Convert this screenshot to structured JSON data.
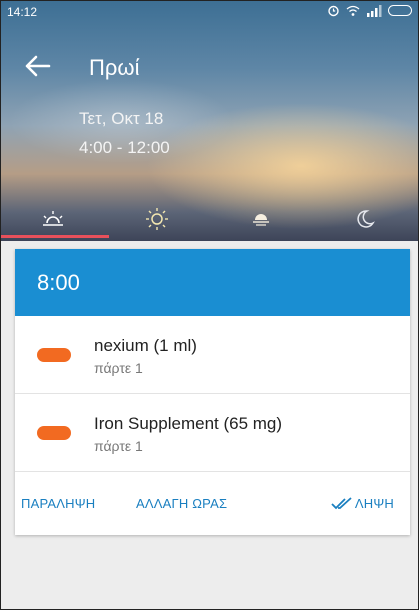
{
  "status_bar": {
    "time": "14:12"
  },
  "header": {
    "title": "Πρωί",
    "date": "Τετ, Οκτ 18",
    "time_range": "4:00 - 12:00"
  },
  "tabs": [
    {
      "icon": "sunrise-icon",
      "active": true
    },
    {
      "icon": "sun-icon",
      "active": false
    },
    {
      "icon": "sunset-icon",
      "active": false
    },
    {
      "icon": "moon-icon",
      "active": false
    }
  ],
  "card": {
    "time": "8:00",
    "meds": [
      {
        "name": "nexium (1 ml)",
        "dose": "πάρτε 1"
      },
      {
        "name": "Iron Supplement (65 mg)",
        "dose": "πάρτε 1"
      }
    ],
    "actions": {
      "skip": "ΠΑΡΑΛΗΨΗ",
      "change_time": "ΑΛΛΑΓΗ ΩΡΑΣ",
      "take": "ΛΗΨΗ"
    }
  },
  "colors": {
    "accent": "#1a8ed2",
    "pill": "#f26a21",
    "tab_indicator": "#e8505b"
  }
}
